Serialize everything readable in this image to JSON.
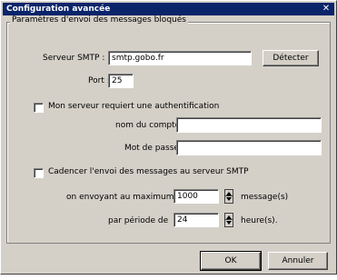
{
  "window": {
    "title": "Configuration avancée"
  },
  "group": {
    "legend": "Paramètres d'envoi des messages bloqués"
  },
  "smtp": {
    "server_label": "Serveur SMTP :",
    "server_value": "smtp.gobo.fr",
    "detect_button": "Détecter",
    "port_label": "Port :",
    "port_value": "25"
  },
  "auth": {
    "checkbox_label": "Mon serveur requiert une authentification",
    "checked": false,
    "account_label": "nom du compte :",
    "account_value": "",
    "password_label": "Mot de passe :",
    "password_value": ""
  },
  "throttle": {
    "checkbox_label": "Cadencer l'envoi des messages au serveur SMTP",
    "checked": false,
    "max_prefix": "on envoyant au maximum",
    "max_value": "1000",
    "max_suffix": "message(s)",
    "period_prefix": "par période de",
    "period_value": "24",
    "period_suffix": "heure(s)."
  },
  "buttons": {
    "ok": "OK",
    "cancel": "Annuler"
  }
}
